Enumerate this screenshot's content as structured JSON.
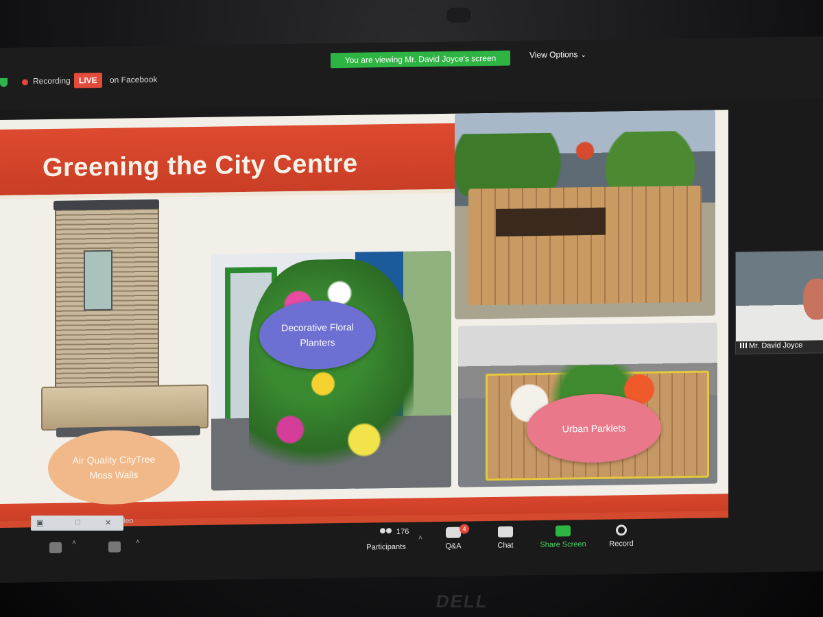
{
  "topbar": {
    "recording_label": "Recording",
    "live_badge": "LIVE",
    "live_destination": "on Facebook",
    "viewing_banner": "You are viewing Mr. David Joyce's screen",
    "view_options_label": "View Options"
  },
  "slide": {
    "title": "Greening the City Centre",
    "bubbles": {
      "floral": "Decorative Floral Planters",
      "parklets": "Urban Parklets",
      "air_quality": "Air Quality CityTree Moss Walls"
    }
  },
  "participant": {
    "name": "Mr. David Joyce"
  },
  "toolbar": {
    "participants_label": "Participants",
    "participants_count": "176",
    "qa_label": "Q&A",
    "qa_badge": "4",
    "chat_label": "Chat",
    "share_label": "Share Screen",
    "record_label": "Record",
    "video_partial": "leo"
  },
  "device": {
    "brand": "DELL"
  },
  "colors": {
    "live_red": "#e54b3c",
    "banner_green": "#2eb443",
    "slide_red": "#d8452c"
  }
}
